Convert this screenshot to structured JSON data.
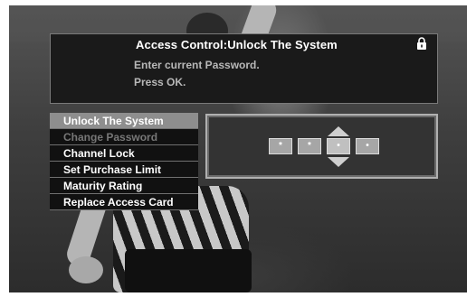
{
  "header": {
    "title": "Access Control:Unlock The System",
    "lock_icon": "padlock-icon",
    "instruction_1": "Enter current Password.",
    "instruction_2": "Press OK."
  },
  "menu": {
    "items": [
      {
        "label": "Unlock The System",
        "state": "selected"
      },
      {
        "label": "Change Password",
        "state": "disabled"
      },
      {
        "label": "Channel Lock",
        "state": "normal"
      },
      {
        "label": "Set Purchase Limit",
        "state": "normal"
      },
      {
        "label": "Maturity Rating",
        "state": "normal"
      },
      {
        "label": "Replace Access Card",
        "state": "normal"
      }
    ]
  },
  "pin_entry": {
    "digits": [
      "*",
      "*",
      "•",
      "•"
    ],
    "active_index": 2,
    "up_icon": "up-arrow-icon",
    "down_icon": "down-arrow-icon"
  },
  "colors": {
    "panel_bg": "#1a1a1a",
    "selected_bg": "#8e8e8e",
    "disabled_text": "#777777"
  }
}
